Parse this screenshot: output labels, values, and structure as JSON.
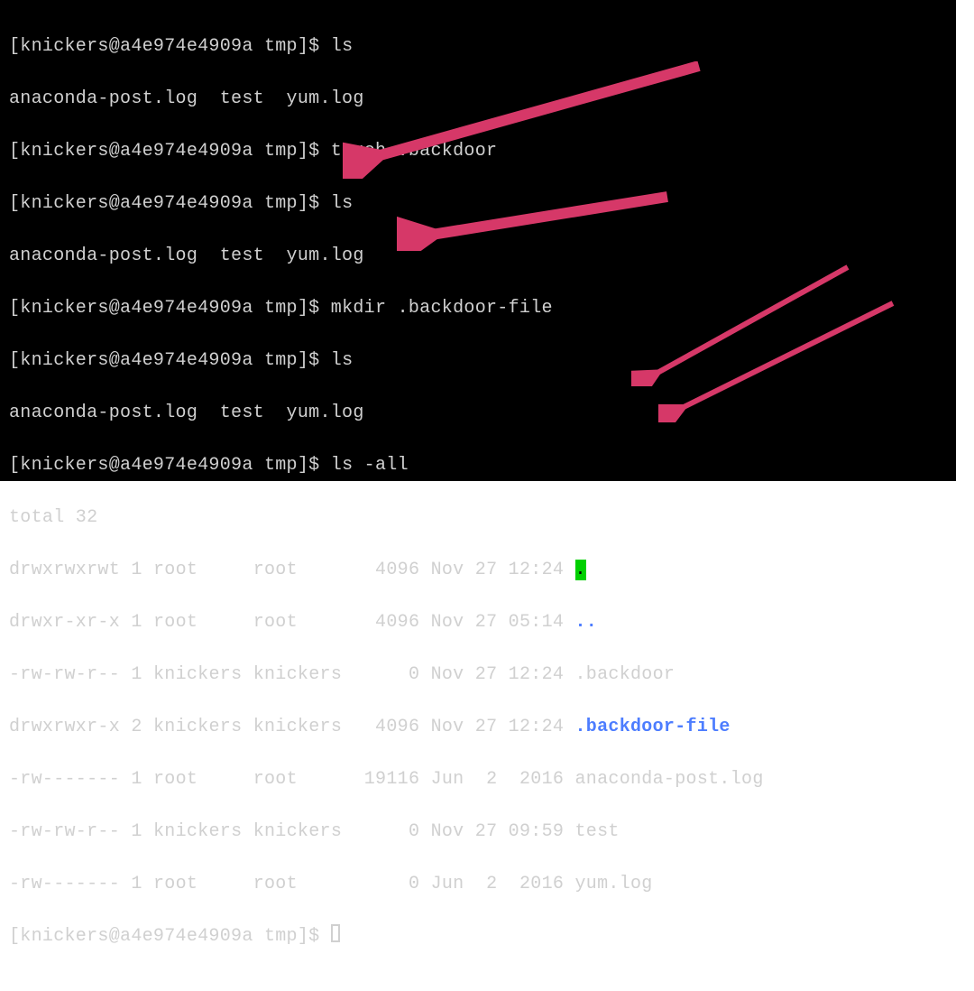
{
  "prompt_prefix": "[knickers@a4e974e4909a tmp]$ ",
  "commands": {
    "ls1": "ls",
    "touch": "touch .backdoor",
    "ls2": "ls",
    "mkdir": "mkdir .backdoor-file",
    "ls3": "ls",
    "lsall": "ls -all"
  },
  "ls_short_output": "anaconda-post.log  test  yum.log",
  "total": "total 32",
  "listing": [
    {
      "perms": "drwxrwxrwt",
      "links": "1",
      "owner": "root    ",
      "group": "root    ",
      "size": "  4096",
      "date": "Nov 27 12:24",
      "name": ".",
      "style": "green-fill"
    },
    {
      "perms": "drwxr-xr-x",
      "links": "1",
      "owner": "root    ",
      "group": "root    ",
      "size": "  4096",
      "date": "Nov 27 05:14",
      "name": "..",
      "style": "blue"
    },
    {
      "perms": "-rw-rw-r--",
      "links": "1",
      "owner": "knickers",
      "group": "knickers",
      "size": "     0",
      "date": "Nov 27 12:24",
      "name": ".backdoor",
      "style": ""
    },
    {
      "perms": "drwxrwxr-x",
      "links": "2",
      "owner": "knickers",
      "group": "knickers",
      "size": "  4096",
      "date": "Nov 27 12:24",
      "name": ".backdoor-file",
      "style": "blue"
    },
    {
      "perms": "-rw-------",
      "links": "1",
      "owner": "root    ",
      "group": "root    ",
      "size": " 19116",
      "date": "Jun  2  2016",
      "name": "anaconda-post.log",
      "style": ""
    },
    {
      "perms": "-rw-rw-r--",
      "links": "1",
      "owner": "knickers",
      "group": "knickers",
      "size": "     0",
      "date": "Nov 27 09:59",
      "name": "test",
      "style": ""
    },
    {
      "perms": "-rw-------",
      "links": "1",
      "owner": "root    ",
      "group": "root    ",
      "size": "     0",
      "date": "Jun  2  2016",
      "name": "yum.log",
      "style": ""
    }
  ],
  "arrows_color": "#d63868"
}
